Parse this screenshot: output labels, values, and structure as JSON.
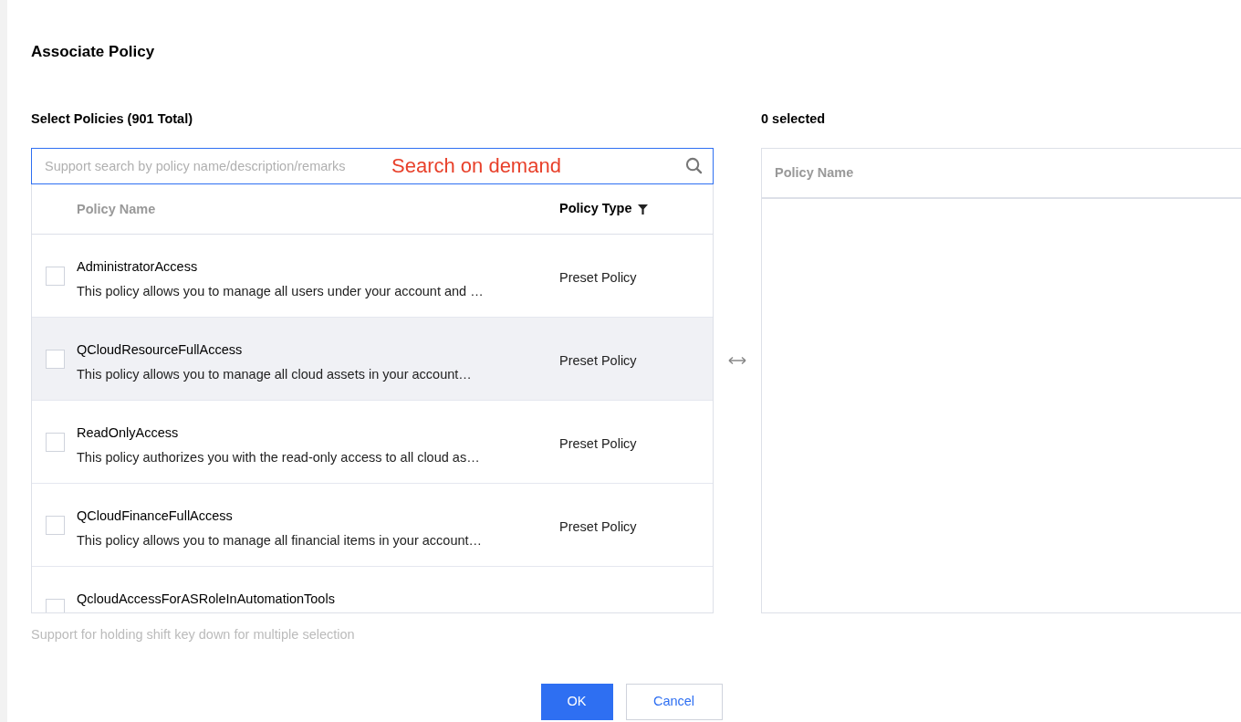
{
  "dialog": {
    "title": "Associate Policy"
  },
  "left": {
    "heading": "Select Policies (901 Total)",
    "search": {
      "placeholder": "Support search by policy name/description/remarks"
    },
    "annotation": "Search on demand",
    "columns": [
      {
        "label": "Policy Name",
        "filter": false
      },
      {
        "label": "Policy Type",
        "filter": true
      }
    ],
    "rows": [
      {
        "name": "AdministratorAccess",
        "description": "This policy allows you to manage all users under your account and …",
        "type": "Preset Policy",
        "checked": false,
        "highlighted": false
      },
      {
        "name": "QCloudResourceFullAccess",
        "description": "This policy allows you to manage all cloud assets in your account…",
        "type": "Preset Policy",
        "checked": false,
        "highlighted": true
      },
      {
        "name": "ReadOnlyAccess",
        "description": "This policy authorizes you with the read-only access to all cloud as…",
        "type": "Preset Policy",
        "checked": false,
        "highlighted": false
      },
      {
        "name": "QCloudFinanceFullAccess",
        "description": "This policy allows you to manage all financial items in your account…",
        "type": "Preset Policy",
        "checked": false,
        "highlighted": false
      },
      {
        "name": "QcloudAccessForASRoleInAutomationTools",
        "checked": false,
        "highlighted": false
      }
    ],
    "hint": "Support for holding shift key down for multiple selection"
  },
  "right": {
    "heading": "0 selected",
    "columns": [
      "Policy Name"
    ]
  },
  "buttons": [
    {
      "label": "OK",
      "kind": "primary"
    },
    {
      "label": "Cancel",
      "kind": "secondary"
    }
  ]
}
